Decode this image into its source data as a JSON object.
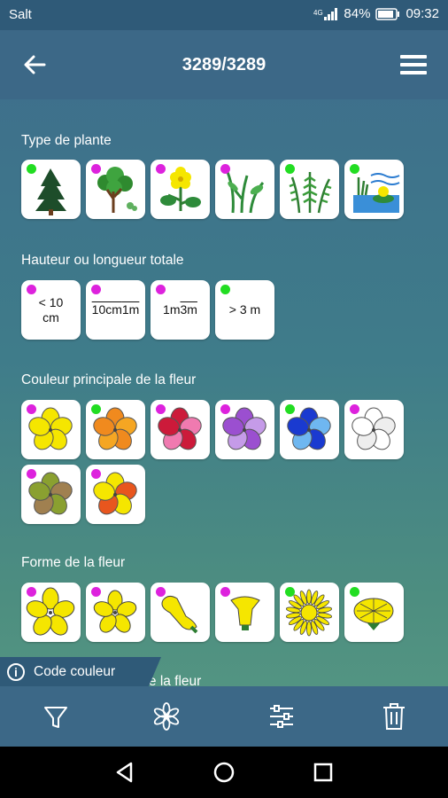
{
  "status_bar": {
    "carrier": "Salt",
    "battery": "84%",
    "time": "09:32"
  },
  "header": {
    "title": "3289/3289",
    "back_icon": "arrow-left-icon",
    "menu_icon": "hamburger-menu-icon"
  },
  "sections": [
    {
      "title": "Type de plante",
      "tiles": [
        {
          "name": "conifer-tree",
          "dot": "#22dd22"
        },
        {
          "name": "deciduous-tree",
          "dot": "#dd22dd"
        },
        {
          "name": "herbaceous-flower",
          "dot": "#dd22dd"
        },
        {
          "name": "grass-plant",
          "dot": "#dd22dd"
        },
        {
          "name": "fern-plant",
          "dot": "#22dd22"
        },
        {
          "name": "aquatic-plant",
          "dot": "#22dd22"
        }
      ]
    },
    {
      "title": "Hauteur ou longueur totale",
      "tiles": [
        {
          "name": "height-lt-10cm",
          "dot": "#dd22dd",
          "label": "< 10\ncm"
        },
        {
          "name": "height-10cm-1m",
          "dot": "#dd22dd",
          "label": "10cm\n1m"
        },
        {
          "name": "height-1m-3m",
          "dot": "#dd22dd",
          "label": "1m\n3m"
        },
        {
          "name": "height-gt-3m",
          "dot": "#22dd22",
          "label": "> 3 m"
        }
      ]
    },
    {
      "title": "Couleur principale de la fleur",
      "tiles": [
        {
          "name": "color-yellow",
          "dot": "#dd22dd",
          "colors": [
            "#f5e600",
            "#f5e600"
          ]
        },
        {
          "name": "color-orange",
          "dot": "#22dd22",
          "colors": [
            "#f08a1e",
            "#f5a623"
          ]
        },
        {
          "name": "color-red-pink",
          "dot": "#dd22dd",
          "colors": [
            "#cc1a3a",
            "#f07ab0"
          ]
        },
        {
          "name": "color-purple",
          "dot": "#dd22dd",
          "colors": [
            "#9b4fd0",
            "#c59be8"
          ]
        },
        {
          "name": "color-blue",
          "dot": "#22dd22",
          "colors": [
            "#1a3ad0",
            "#6fb7f0"
          ]
        },
        {
          "name": "color-white",
          "dot": "#dd22dd",
          "colors": [
            "#ffffff",
            "#eeeeee"
          ]
        },
        {
          "name": "color-green-brown",
          "dot": "#dd22dd",
          "colors": [
            "#8aa030",
            "#a08050"
          ]
        },
        {
          "name": "color-multicolor",
          "dot": "#dd22dd",
          "colors": [
            "#f5e600",
            "#e8561e"
          ]
        }
      ]
    },
    {
      "title": "Forme de la fleur",
      "tiles": [
        {
          "name": "shape-5-petals",
          "dot": "#dd22dd"
        },
        {
          "name": "shape-5-petals-small",
          "dot": "#dd22dd"
        },
        {
          "name": "shape-irregular",
          "dot": "#dd22dd"
        },
        {
          "name": "shape-bell",
          "dot": "#dd22dd"
        },
        {
          "name": "shape-daisy",
          "dot": "#22dd22"
        },
        {
          "name": "shape-dandelion",
          "dot": "#22dd22"
        }
      ]
    },
    {
      "title": "Nombre de pétales de la fleur"
    }
  ],
  "code_couleur": {
    "label": "Code couleur",
    "icon": "info-icon"
  },
  "bottom_bar": [
    "filter-icon",
    "flower-icon",
    "sliders-icon",
    "trash-icon"
  ],
  "nav_bar": [
    "back-triangle-icon",
    "home-circle-icon",
    "recents-square-icon"
  ]
}
